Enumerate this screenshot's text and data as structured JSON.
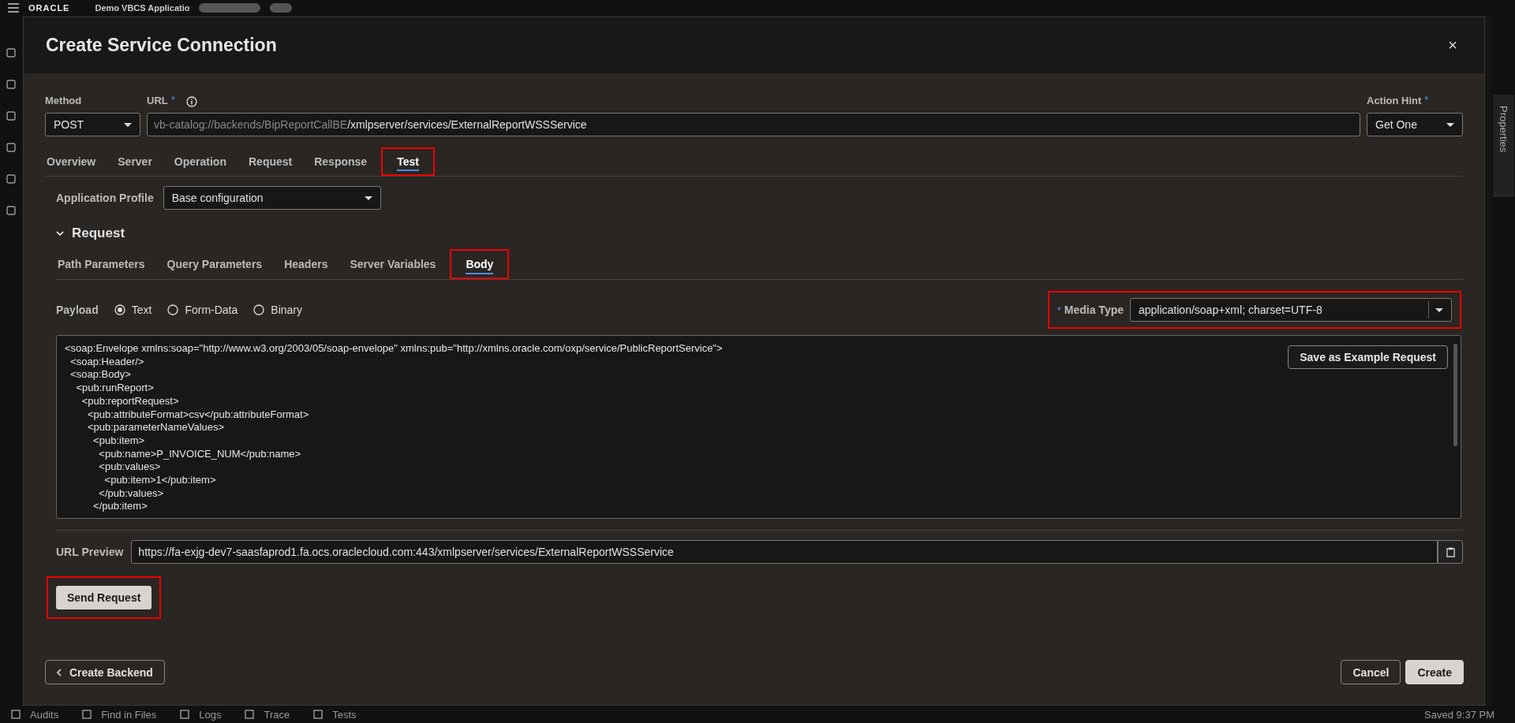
{
  "app_bar": {
    "logo": "ORACLE",
    "title": "Demo VBCS Applicatio"
  },
  "right_panel": {
    "tab": "Properties"
  },
  "dialog": {
    "title": "Create Service Connection",
    "close": "×",
    "method": {
      "label": "Method",
      "value": "POST"
    },
    "url": {
      "label": "URL",
      "required_mark": "*",
      "prefix": "vb-catalog://backends/BipReportCallBE",
      "path": "/xmlpserver/services/ExternalReportWSSService"
    },
    "action_hint": {
      "label": "Action Hint",
      "required_mark": "*",
      "value": "Get One"
    },
    "tabs": [
      {
        "label": "Overview",
        "selected": false,
        "highlighted": false
      },
      {
        "label": "Server",
        "selected": false,
        "highlighted": false
      },
      {
        "label": "Operation",
        "selected": false,
        "highlighted": false
      },
      {
        "label": "Request",
        "selected": false,
        "highlighted": false
      },
      {
        "label": "Response",
        "selected": false,
        "highlighted": false
      },
      {
        "label": "Test",
        "selected": true,
        "highlighted": true
      }
    ],
    "application_profile": {
      "label": "Application Profile",
      "value": "Base configuration"
    },
    "request_section": {
      "title": "Request",
      "expanded": true
    },
    "subtabs": [
      {
        "label": "Path Parameters",
        "selected": false,
        "highlighted": false
      },
      {
        "label": "Query Parameters",
        "selected": false,
        "highlighted": false
      },
      {
        "label": "Headers",
        "selected": false,
        "highlighted": false
      },
      {
        "label": "Server Variables",
        "selected": false,
        "highlighted": false
      },
      {
        "label": "Body",
        "selected": true,
        "highlighted": true
      }
    ],
    "payload": {
      "label": "Payload",
      "options": [
        {
          "label": "Text",
          "selected": true
        },
        {
          "label": "Form-Data",
          "selected": false
        },
        {
          "label": "Binary",
          "selected": false
        }
      ]
    },
    "media_type": {
      "label": "Media Type",
      "required_mark": "*",
      "value": "application/soap+xml; charset=UTF-8",
      "highlighted": true
    },
    "body_lines": [
      "<soap:Envelope xmlns:soap=\"http://www.w3.org/2003/05/soap-envelope\" xmlns:pub=\"http://xmlns.oracle.com/oxp/service/PublicReportService\">",
      "  <soap:Header/>",
      "  <soap:Body>",
      "    <pub:runReport>",
      "      <pub:reportRequest>",
      "        <pub:attributeFormat>csv</pub:attributeFormat>",
      "        <pub:parameterNameValues>",
      "          <pub:item>",
      "            <pub:name>P_INVOICE_NUM</pub:name>",
      "            <pub:values>",
      "              <pub:item>1</pub:item>",
      "            </pub:values>",
      "          </pub:item>"
    ],
    "save_example_button": "Save as Example Request",
    "url_preview": {
      "label": "URL Preview",
      "value": "https://fa-exjg-dev7-saasfaprod1.fa.ocs.oraclecloud.com:443/xmlpserver/services/ExternalReportWSSService"
    },
    "send_button": {
      "label": "Send Request",
      "highlighted": true
    },
    "back_button": "Create Backend",
    "cancel_button": "Cancel",
    "create_button": "Create"
  },
  "bottom_bar": {
    "items": [
      "Audits",
      "Find in Files",
      "Logs",
      "Trace",
      "Tests"
    ],
    "status": "Saved 9:37 PM"
  }
}
